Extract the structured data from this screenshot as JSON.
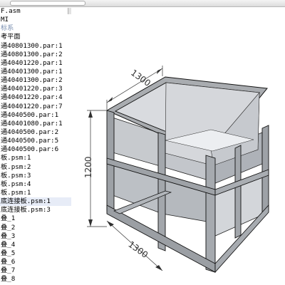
{
  "tree": {
    "items": [
      {
        "label": "F.asm"
      },
      {
        "label": "MI"
      },
      {
        "label": "标系"
      },
      {
        "label": "考平面"
      },
      {
        "label": "通40801300.par:1"
      },
      {
        "label": "通40801300.par:2"
      },
      {
        "label": "通40401220.par:1"
      },
      {
        "label": "通40401300.par:1"
      },
      {
        "label": "通40401300.par:2"
      },
      {
        "label": "通40401220.par:3"
      },
      {
        "label": "通40401220.par:4"
      },
      {
        "label": "通40401220.par:7"
      },
      {
        "label": "通4040500.par:1"
      },
      {
        "label": "通40401080.par:1"
      },
      {
        "label": "通4040500.par:2"
      },
      {
        "label": "通4040500.par:5"
      },
      {
        "label": "通4040500.par:6"
      },
      {
        "label": "板.psm:1"
      },
      {
        "label": "板.psm:2"
      },
      {
        "label": "板.psm:3"
      },
      {
        "label": "板.psm:4"
      },
      {
        "label": "板.psm:1"
      },
      {
        "label": "底连接板.psm:1"
      },
      {
        "label": "底连接板.psm:3"
      },
      {
        "label": "叠_1"
      },
      {
        "label": "叠_2"
      },
      {
        "label": "叠_3"
      },
      {
        "label": "叠_4"
      },
      {
        "label": "叠_5"
      },
      {
        "label": "叠_6"
      },
      {
        "label": "叠_7"
      },
      {
        "label": "叠_8"
      }
    ]
  },
  "dimensions": {
    "top_width": "1300",
    "height": "1200",
    "bottom_width": "1300"
  },
  "colors": {
    "frame": "#a6a9ad",
    "panel_light": "#dcdee2",
    "panel_mid": "#c9ccd0",
    "panel_dark": "#b6b9be",
    "edge": "#1a1a1a",
    "dimension": "#303030"
  }
}
